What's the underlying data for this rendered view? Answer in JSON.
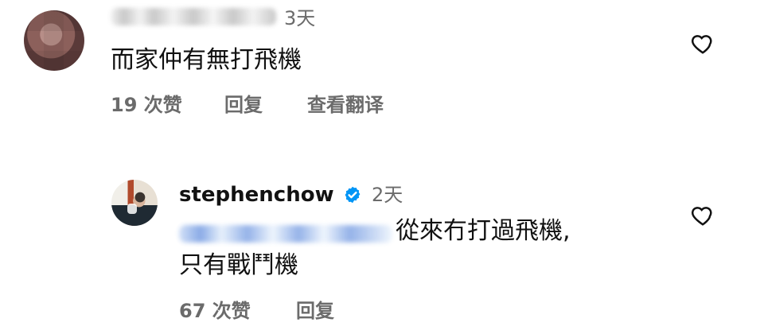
{
  "comments": [
    {
      "time": "3天",
      "text": "而家仲有無打飛機",
      "likes": "19 次赞",
      "reply": "回复",
      "translate": "查看翻译",
      "icons": {
        "like": "heart-outline-icon"
      }
    },
    {
      "username": "stephenchow",
      "time": "2天",
      "text_line1": "從來冇打過飛機,",
      "text_line2": "只有戰鬥機",
      "likes": "67 次赞",
      "reply": "回复",
      "icons": {
        "verified": "verified-badge-icon",
        "like": "heart-outline-icon"
      }
    }
  ],
  "colors": {
    "text_primary": "#111111",
    "text_secondary": "#6b6b6b",
    "verified_blue": "#0095f6"
  }
}
